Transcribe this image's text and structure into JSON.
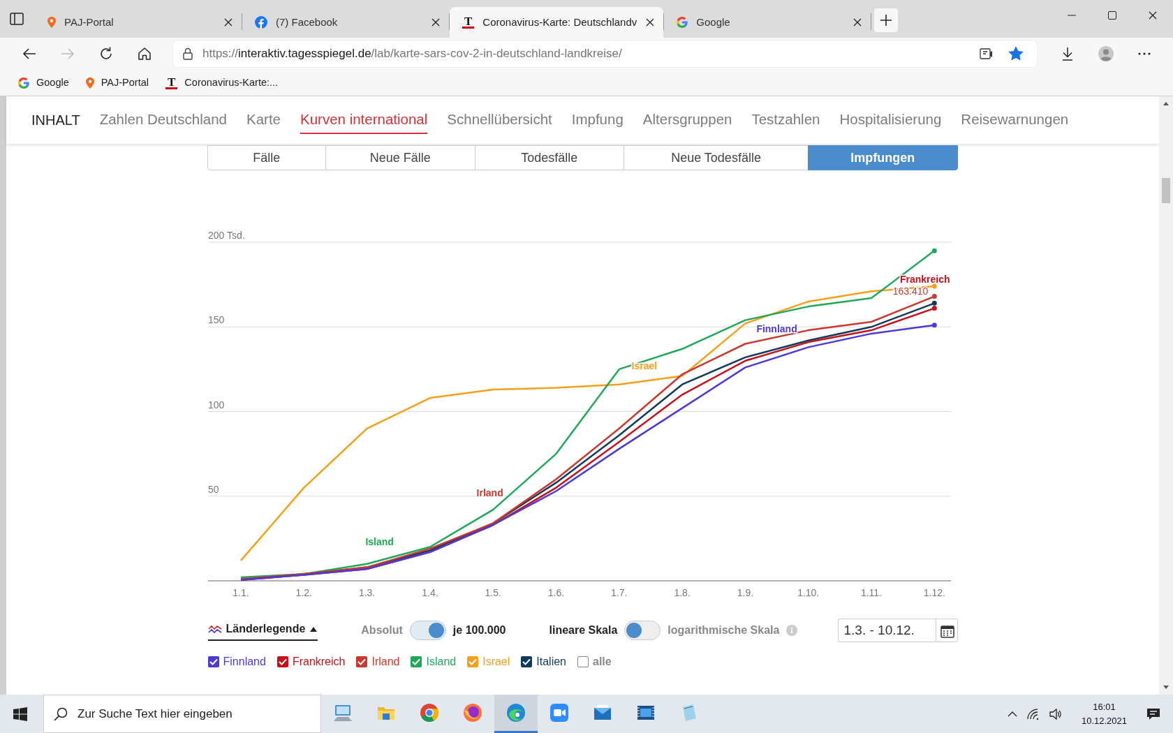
{
  "browser": {
    "tabs": [
      {
        "title": "PAJ-Portal",
        "kind": "pin",
        "selected": false
      },
      {
        "title": "(7) Facebook",
        "kind": "facebook",
        "selected": false
      },
      {
        "title": "Coronavirus-Karte: Deutschlandv",
        "kind": "tagesspiegel",
        "mark": "T",
        "selected": true
      },
      {
        "title": "Google",
        "kind": "google",
        "selected": false
      }
    ],
    "address": {
      "scheme": "https://",
      "host": "interaktiv.tagesspiegel.de",
      "path": "/lab/karte-sars-cov-2-in-deutschland-landkreise/"
    },
    "favorite": true,
    "bookmarks": [
      {
        "label": "Google",
        "kind": "google"
      },
      {
        "label": "PAJ-Portal",
        "kind": "pin"
      },
      {
        "label": "Coronavirus-Karte:...",
        "kind": "tagesspiegel",
        "mark": "T"
      }
    ]
  },
  "page_nav": {
    "title": "INHALT",
    "items": [
      {
        "label": "Zahlen Deutschland",
        "selected": false
      },
      {
        "label": "Karte",
        "selected": false
      },
      {
        "label": "Kurven international",
        "selected": true
      },
      {
        "label": "Schnellübersicht",
        "selected": false
      },
      {
        "label": "Impfung",
        "selected": false
      },
      {
        "label": "Altersgruppen",
        "selected": false
      },
      {
        "label": "Testzahlen",
        "selected": false
      },
      {
        "label": "Hospitalisierung",
        "selected": false
      },
      {
        "label": "Reisewarnungen",
        "selected": false
      }
    ]
  },
  "metric_tabs": [
    {
      "label": "Fälle",
      "selected": false
    },
    {
      "label": "Neue Fälle",
      "selected": false
    },
    {
      "label": "Todesfälle",
      "selected": false
    },
    {
      "label": "Neue Todesfälle",
      "selected": false
    },
    {
      "label": "Impfungen",
      "selected": true
    }
  ],
  "chart_data": {
    "type": "line",
    "categories": [
      "1.1.",
      "1.2.",
      "1.3.",
      "1.4.",
      "1.5.",
      "1.6.",
      "1.7.",
      "1.8.",
      "1.9.",
      "1.10.",
      "1.11.",
      "1.12."
    ],
    "ylim": [
      0,
      200
    ],
    "yticks": [
      50,
      100,
      150,
      {
        "value": 200,
        "label": "200 Tsd."
      }
    ],
    "grid": true,
    "series": [
      {
        "name": "Finnland",
        "color": "#4b3ad6",
        "values": [
          0.5,
          3.5,
          7,
          17,
          33,
          53,
          78,
          102,
          126,
          138,
          146,
          151
        ]
      },
      {
        "name": "Frankreich",
        "color": "#c8101a",
        "values": [
          0.5,
          3.5,
          7,
          17,
          33,
          55,
          82,
          110,
          130,
          141,
          148,
          161
        ]
      },
      {
        "name": "Irland",
        "color": "#c9392f",
        "values": [
          1,
          4,
          8,
          19,
          34,
          60,
          90,
          122,
          140,
          148,
          153,
          168
        ]
      },
      {
        "name": "Island",
        "color": "#1fa85a",
        "values": [
          2,
          4,
          10,
          20,
          42,
          75,
          125,
          137,
          154,
          162,
          167,
          195
        ]
      },
      {
        "name": "Israel",
        "color": "#f5a01a",
        "values": [
          12,
          55,
          90,
          108,
          113,
          114,
          116,
          121,
          152,
          165,
          171,
          174
        ]
      },
      {
        "color": "#0f3a5c",
        "values": [
          0.5,
          4,
          8,
          18,
          34,
          58,
          86,
          116,
          132,
          142,
          150,
          164
        ]
      }
    ],
    "annotations": [
      {
        "text": "163.410",
        "x": "1.12.",
        "y": 169
      }
    ]
  },
  "controls": {
    "legend_toggle": {
      "label": "Länderlegende",
      "expanded": true
    },
    "switches": [
      {
        "left": "Absolut",
        "right": "je 100.000",
        "right_selected": true
      },
      {
        "left": "lineare Skala",
        "right": "logarithmische Skala",
        "right_selected": false,
        "info": true
      }
    ],
    "date_range": {
      "value": "1.3. - 10.12."
    }
  },
  "countries": [
    {
      "label": "Finnland",
      "checked": true,
      "color": "#4b3ad6"
    },
    {
      "label": "Frankreich",
      "checked": true,
      "color": "#c8101a"
    },
    {
      "label": "Irland",
      "checked": true,
      "color": "#c9392f"
    },
    {
      "label": "Island",
      "checked": true,
      "color": "#1fa85a"
    },
    {
      "label": "Israel",
      "checked": true,
      "color": "#f5a01a"
    },
    {
      "label": "Italien",
      "checked": true,
      "color": "#0f3a5c"
    },
    {
      "label": "alle",
      "checked": false,
      "color": "#888888"
    }
  ],
  "taskbar": {
    "search": {
      "placeholder": "Zur Suche Text hier eingeben"
    },
    "apps": [
      {
        "kind": "computer",
        "active": false
      },
      {
        "kind": "folder",
        "active": false
      },
      {
        "kind": "chrome",
        "active": false
      },
      {
        "kind": "firefox",
        "active": false
      },
      {
        "kind": "edge",
        "active": true
      },
      {
        "kind": "video-call",
        "active": false
      },
      {
        "kind": "mail",
        "active": false
      },
      {
        "kind": "film",
        "active": false
      },
      {
        "kind": "notepad",
        "active": false
      }
    ],
    "time": "16:01",
    "date": "10.12.2021"
  }
}
